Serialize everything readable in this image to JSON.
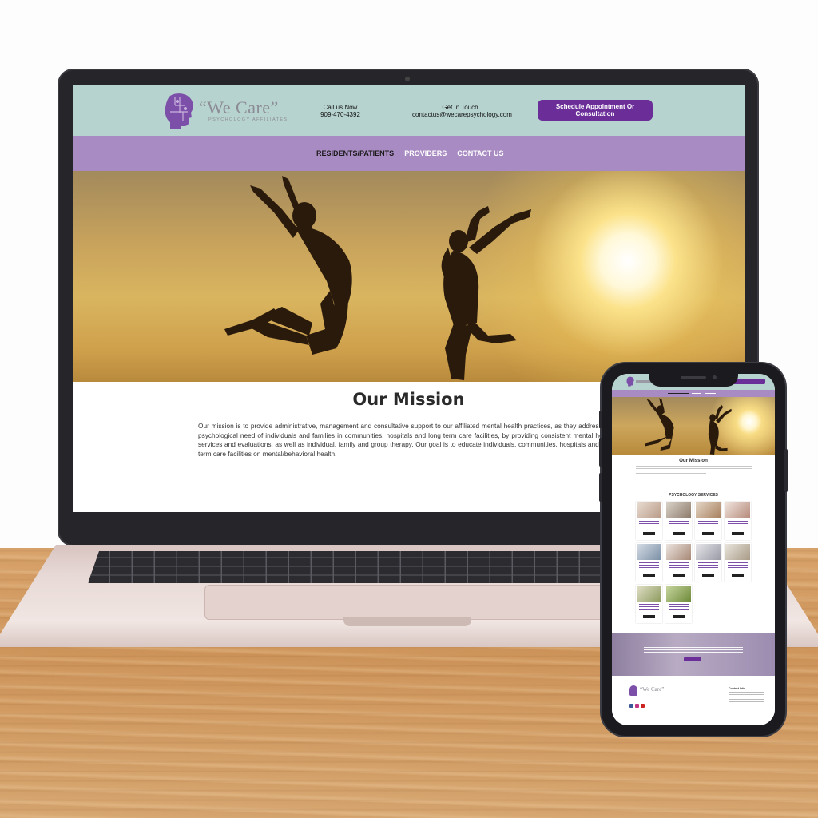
{
  "colors": {
    "header_bg": "#b7d3cf",
    "nav_bg": "#a98bc3",
    "brand_purple": "#6b2e99",
    "logo_gray": "#8c8c96"
  },
  "desktop": {
    "logo": {
      "word": "“We Care”",
      "tagline": "PSYCHOLOGY AFFILIATES"
    },
    "call": {
      "label": "Call us Now",
      "phone": "909-470-4392"
    },
    "touch": {
      "label": "Get In Touch",
      "email": "contactus@wecarepsychology.com"
    },
    "cta": {
      "line1": "Schedule Appointment Or",
      "line2": "Consultation"
    },
    "nav": [
      {
        "label": "RESIDENTS/PATIENTS"
      },
      {
        "label": "PROVIDERS"
      },
      {
        "label": "CONTACT US"
      }
    ],
    "mission": {
      "title": "Our Mission",
      "body": "Our mission is to provide administrative, management and consultative support to our affiliated mental health practices, as they address the psychological need of individuals and families in communities, hospitals and long term care facilities, by providing consistent mental health services and evaluations, as well as individual, family and group therapy. Our goal is to educate individuals, communities, hospitals and long term care facilities on mental/behavioral health."
    }
  },
  "mobile": {
    "mission_title": "Our Mission",
    "services_title": "PSYCHOLOGY SERVICES",
    "footer_logo": "“We Care”",
    "footer_contact": "Contact Info"
  }
}
